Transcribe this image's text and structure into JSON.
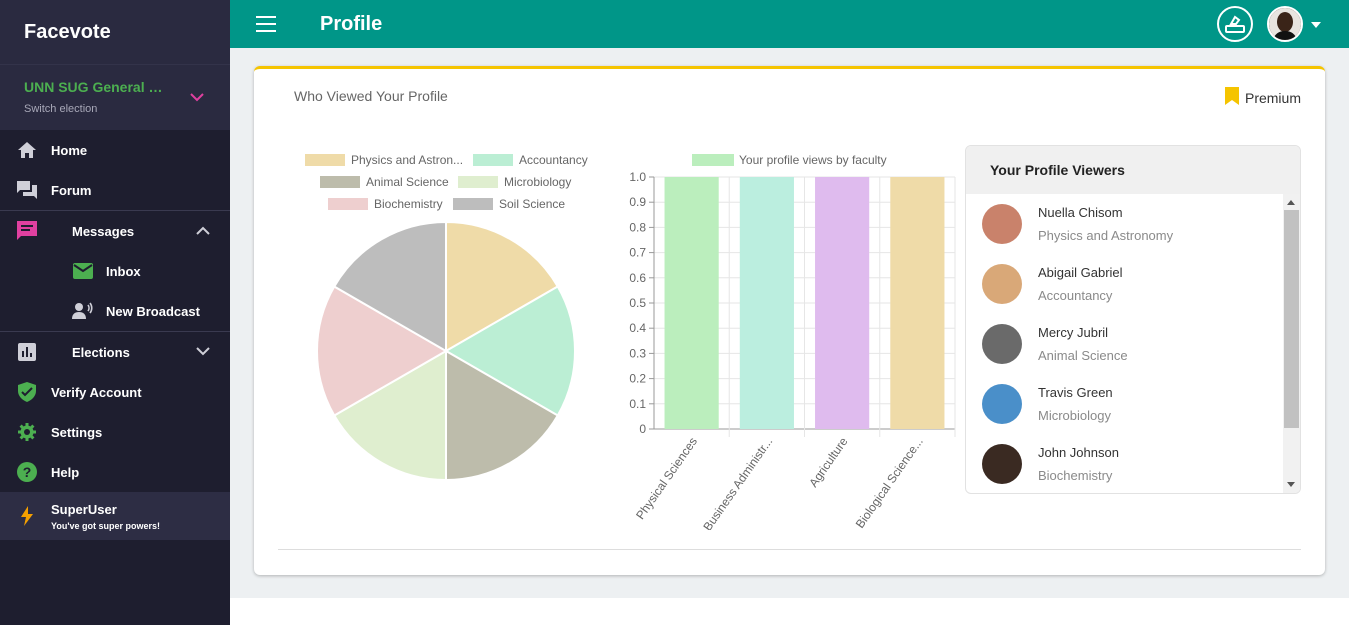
{
  "app": {
    "brand": "Facevote"
  },
  "election": {
    "name": "UNN SUG General El...",
    "sub": "Switch election"
  },
  "sidebar": {
    "items": [
      {
        "label": "Home",
        "icon": "home-icon"
      },
      {
        "label": "Forum",
        "icon": "forum-icon"
      },
      {
        "label": "Messages",
        "icon": "message-icon"
      },
      {
        "label": "Inbox",
        "icon": "mail-icon"
      },
      {
        "label": "New Broadcast",
        "icon": "broadcast-icon"
      },
      {
        "label": "Elections",
        "icon": "chart-icon"
      },
      {
        "label": "Verify Account",
        "icon": "shield-check-icon"
      },
      {
        "label": "Settings",
        "icon": "gear-icon"
      },
      {
        "label": "Help",
        "icon": "help-icon"
      }
    ],
    "superuser": {
      "title": "SuperUser",
      "sub": "You've got super powers!"
    }
  },
  "header": {
    "title": "Profile"
  },
  "card": {
    "title": "Who Viewed Your Profile",
    "premium": "Premium"
  },
  "colors": {
    "teal": "#009688",
    "accent": "#f5c400",
    "green": "#4caf50"
  },
  "chart_data": [
    {
      "type": "pie",
      "legend": [
        "Physics and Astron...",
        "Accountancy",
        "Animal Science",
        "Microbiology",
        "Biochemistry",
        "Soil Science"
      ],
      "values": [
        1,
        1,
        1,
        1,
        1,
        1
      ],
      "colors": [
        "#efdba8",
        "#bbeed4",
        "#bdbcab",
        "#dfeecf",
        "#eecfcf",
        "#bdbdbd"
      ]
    },
    {
      "type": "bar",
      "categories": [
        "Physical Sciences",
        "Business Administr...",
        "Agriculture",
        "Biological Science..."
      ],
      "series": [
        {
          "name": "Your profile views by faculty",
          "values": [
            1,
            1,
            1,
            1
          ]
        }
      ],
      "colors": [
        "#bbeebd",
        "#bbeedf",
        "#dfbbee",
        "#efdba8"
      ],
      "ylim": [
        0,
        1
      ],
      "yticks": [
        "0",
        "0.1",
        "0.2",
        "0.3",
        "0.4",
        "0.5",
        "0.6",
        "0.7",
        "0.8",
        "0.9",
        "1.0"
      ]
    }
  ],
  "viewers": {
    "title": "Your Profile Viewers",
    "items": [
      {
        "name": "Nuella Chisom",
        "faculty": "Physics and Astronomy",
        "color": "#c9826b"
      },
      {
        "name": "Abigail Gabriel",
        "faculty": "Accountancy",
        "color": "#d9a878"
      },
      {
        "name": "Mercy Jubril",
        "faculty": "Animal Science",
        "color": "#6a6a6a"
      },
      {
        "name": "Travis Green",
        "faculty": "Microbiology",
        "color": "#4a8fc9"
      },
      {
        "name": "John Johnson",
        "faculty": "Biochemistry",
        "color": "#3a2a22"
      }
    ]
  }
}
